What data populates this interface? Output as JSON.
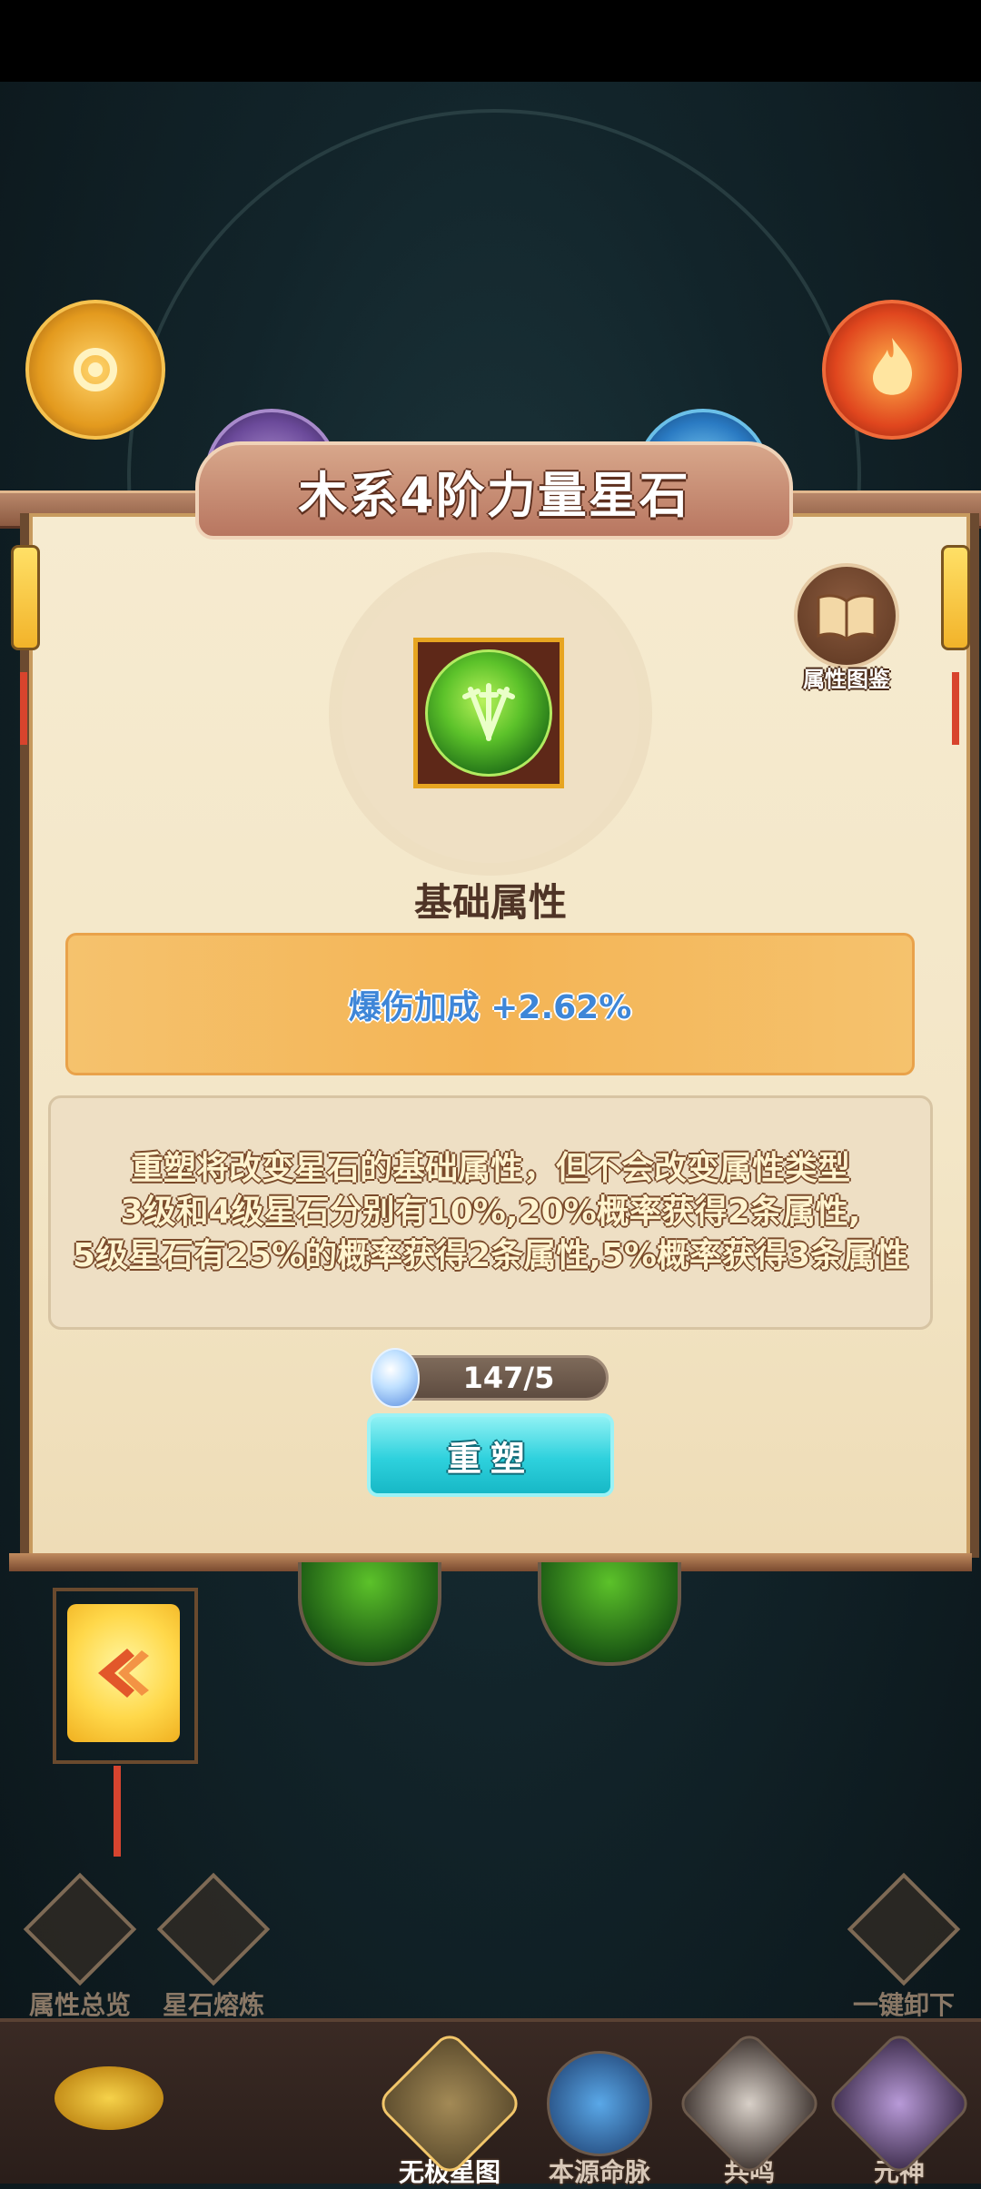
{
  "dialog": {
    "title": "木系4阶力量星石",
    "codex_label": "属性图鉴",
    "section_title": "基础属性",
    "attribute": "爆伤加成 +2.62%",
    "description": [
      "重塑将改变星石的基础属性，但不会改变属性类型",
      "3级和4级星石分别有10%,20%概率获得2条属性,",
      "5级星石有25%的概率获得2条属性,5%概率获得3条属性"
    ],
    "cost": "147/5",
    "reshape_label": "重塑"
  },
  "actions": {
    "overview": "属性总览",
    "smelt": "星石熔炼",
    "unload_all": "一键卸下"
  },
  "nav": {
    "items": [
      {
        "label": "无极星图",
        "active": true
      },
      {
        "label": "本源命脉",
        "active": false
      },
      {
        "label": "共鸣",
        "active": false
      },
      {
        "label": "元神",
        "active": false
      }
    ]
  },
  "colors": {
    "accent_cyan": "#2ed1dd",
    "attr_blue": "#3e86d8",
    "gold": "#e7a521"
  }
}
